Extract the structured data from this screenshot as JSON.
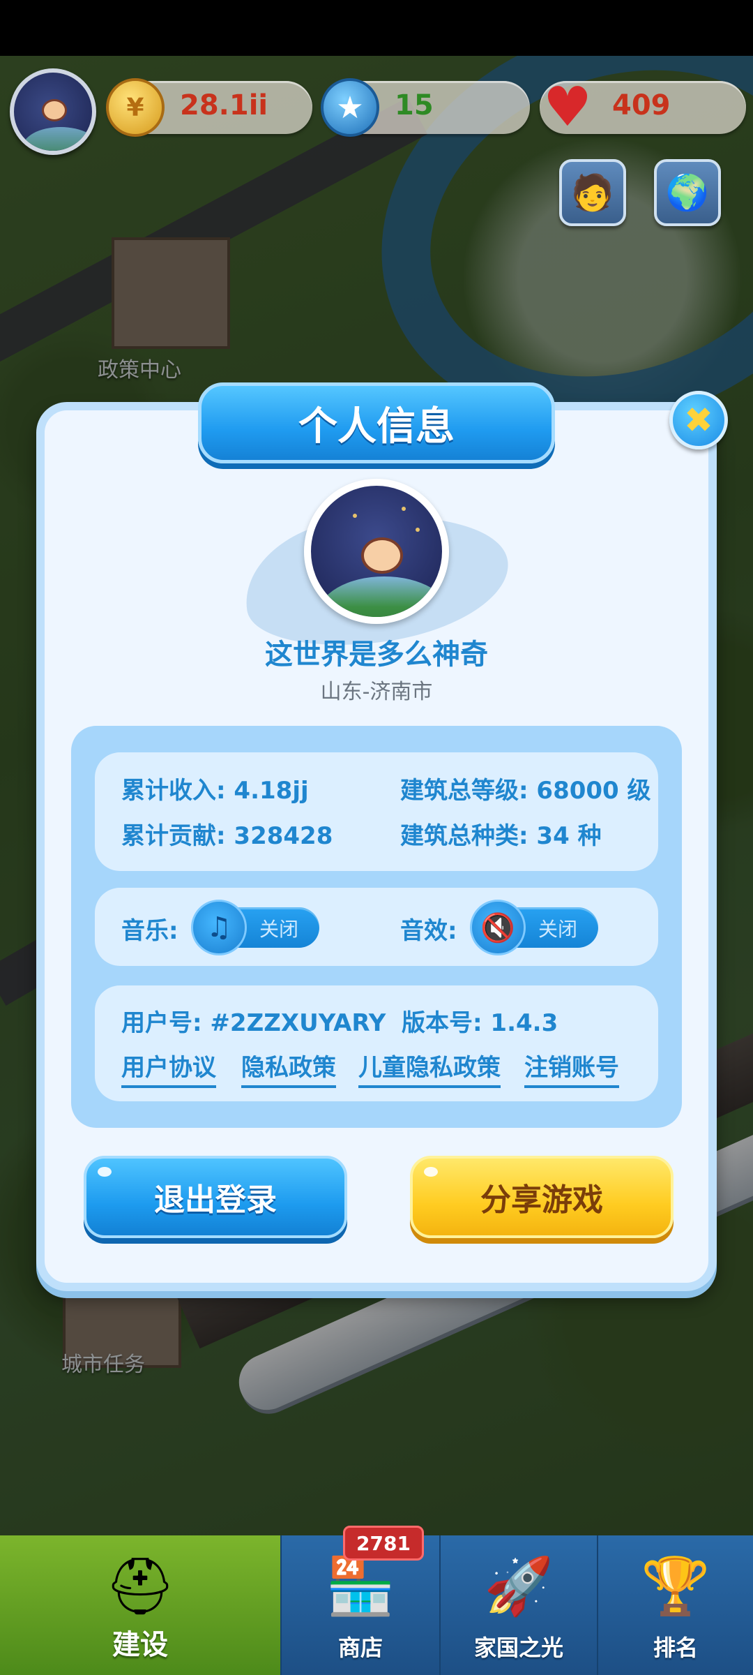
{
  "hud": {
    "coins": "28.1ii",
    "stars": "15",
    "hearts": "409",
    "coin_icon_glyph": "¥"
  },
  "background": {
    "label_policy": "政策中心",
    "label_tasks": "城市任务"
  },
  "dialog": {
    "title": "个人信息",
    "nickname": "这世界是多么神奇",
    "location": "山东-济南市",
    "stats": {
      "income": "累计收入: 4.18jj",
      "building_level": "建筑总等级: 68000 级",
      "contribution": "累计贡献: 328428",
      "building_types": "建筑总种类: 34 种"
    },
    "music": {
      "label": "音乐:",
      "state": "关闭"
    },
    "sound": {
      "label": "音效:",
      "state": "关闭"
    },
    "user_id": "用户号: #2ZZXUYARY",
    "version": "版本号: 1.4.3",
    "links": [
      "用户协议",
      "隐私政策",
      "儿童隐私政策",
      "注销账号"
    ],
    "logout_label": "退出登录",
    "share_label": "分享游戏"
  },
  "nav": {
    "items": [
      {
        "label": "建设",
        "icon": "hardhat-icon",
        "active": true
      },
      {
        "label": "商店",
        "icon": "shop-icon",
        "active": false
      },
      {
        "label": "家国之光",
        "icon": "rocket-icon",
        "active": false
      },
      {
        "label": "排名",
        "icon": "trophy-icon",
        "active": false
      }
    ],
    "shop_badge": "2781"
  },
  "colors": {
    "accent_blue": "#1f86cf",
    "button_blue": "#1d9bef",
    "button_yellow": "#ffcc21",
    "nav_active": "#7cb52c"
  }
}
